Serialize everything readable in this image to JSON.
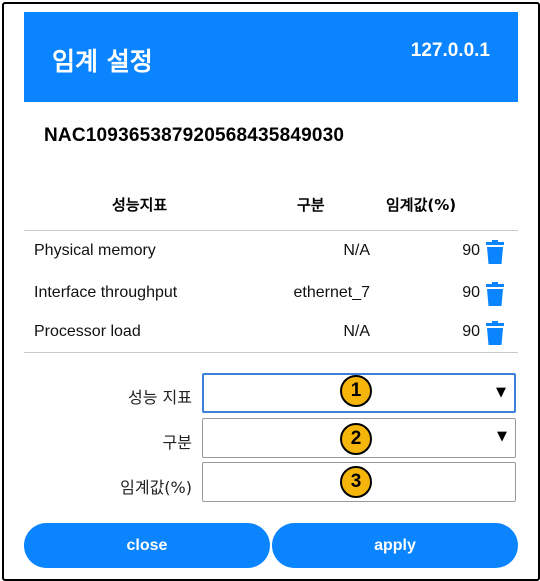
{
  "header": {
    "title": "임계 설정",
    "ip": "127.0.0.1"
  },
  "device_id": "NAC109365387920568435849030",
  "table": {
    "columns": [
      "성능지표",
      "구분",
      "임계값(%)"
    ],
    "rows": [
      {
        "metric": "Physical memory",
        "type": "N/A",
        "threshold": "90"
      },
      {
        "metric": "Interface throughput",
        "type": "ethernet_7",
        "threshold": "90"
      },
      {
        "metric": "Processor load",
        "type": "N/A",
        "threshold": "90"
      }
    ]
  },
  "form": {
    "metric_label": "성능 지표",
    "type_label": "구분",
    "threshold_label": "임계값(%)",
    "metric_value": "",
    "type_value": "",
    "threshold_value": ""
  },
  "badges": [
    "1",
    "2",
    "3"
  ],
  "buttons": {
    "close": "close",
    "apply": "apply"
  },
  "colors": {
    "accent": "#0a84ff",
    "badge": "#f5b50a"
  },
  "icons": {
    "delete": "trash-icon",
    "dropdown": "caret-down-icon"
  }
}
